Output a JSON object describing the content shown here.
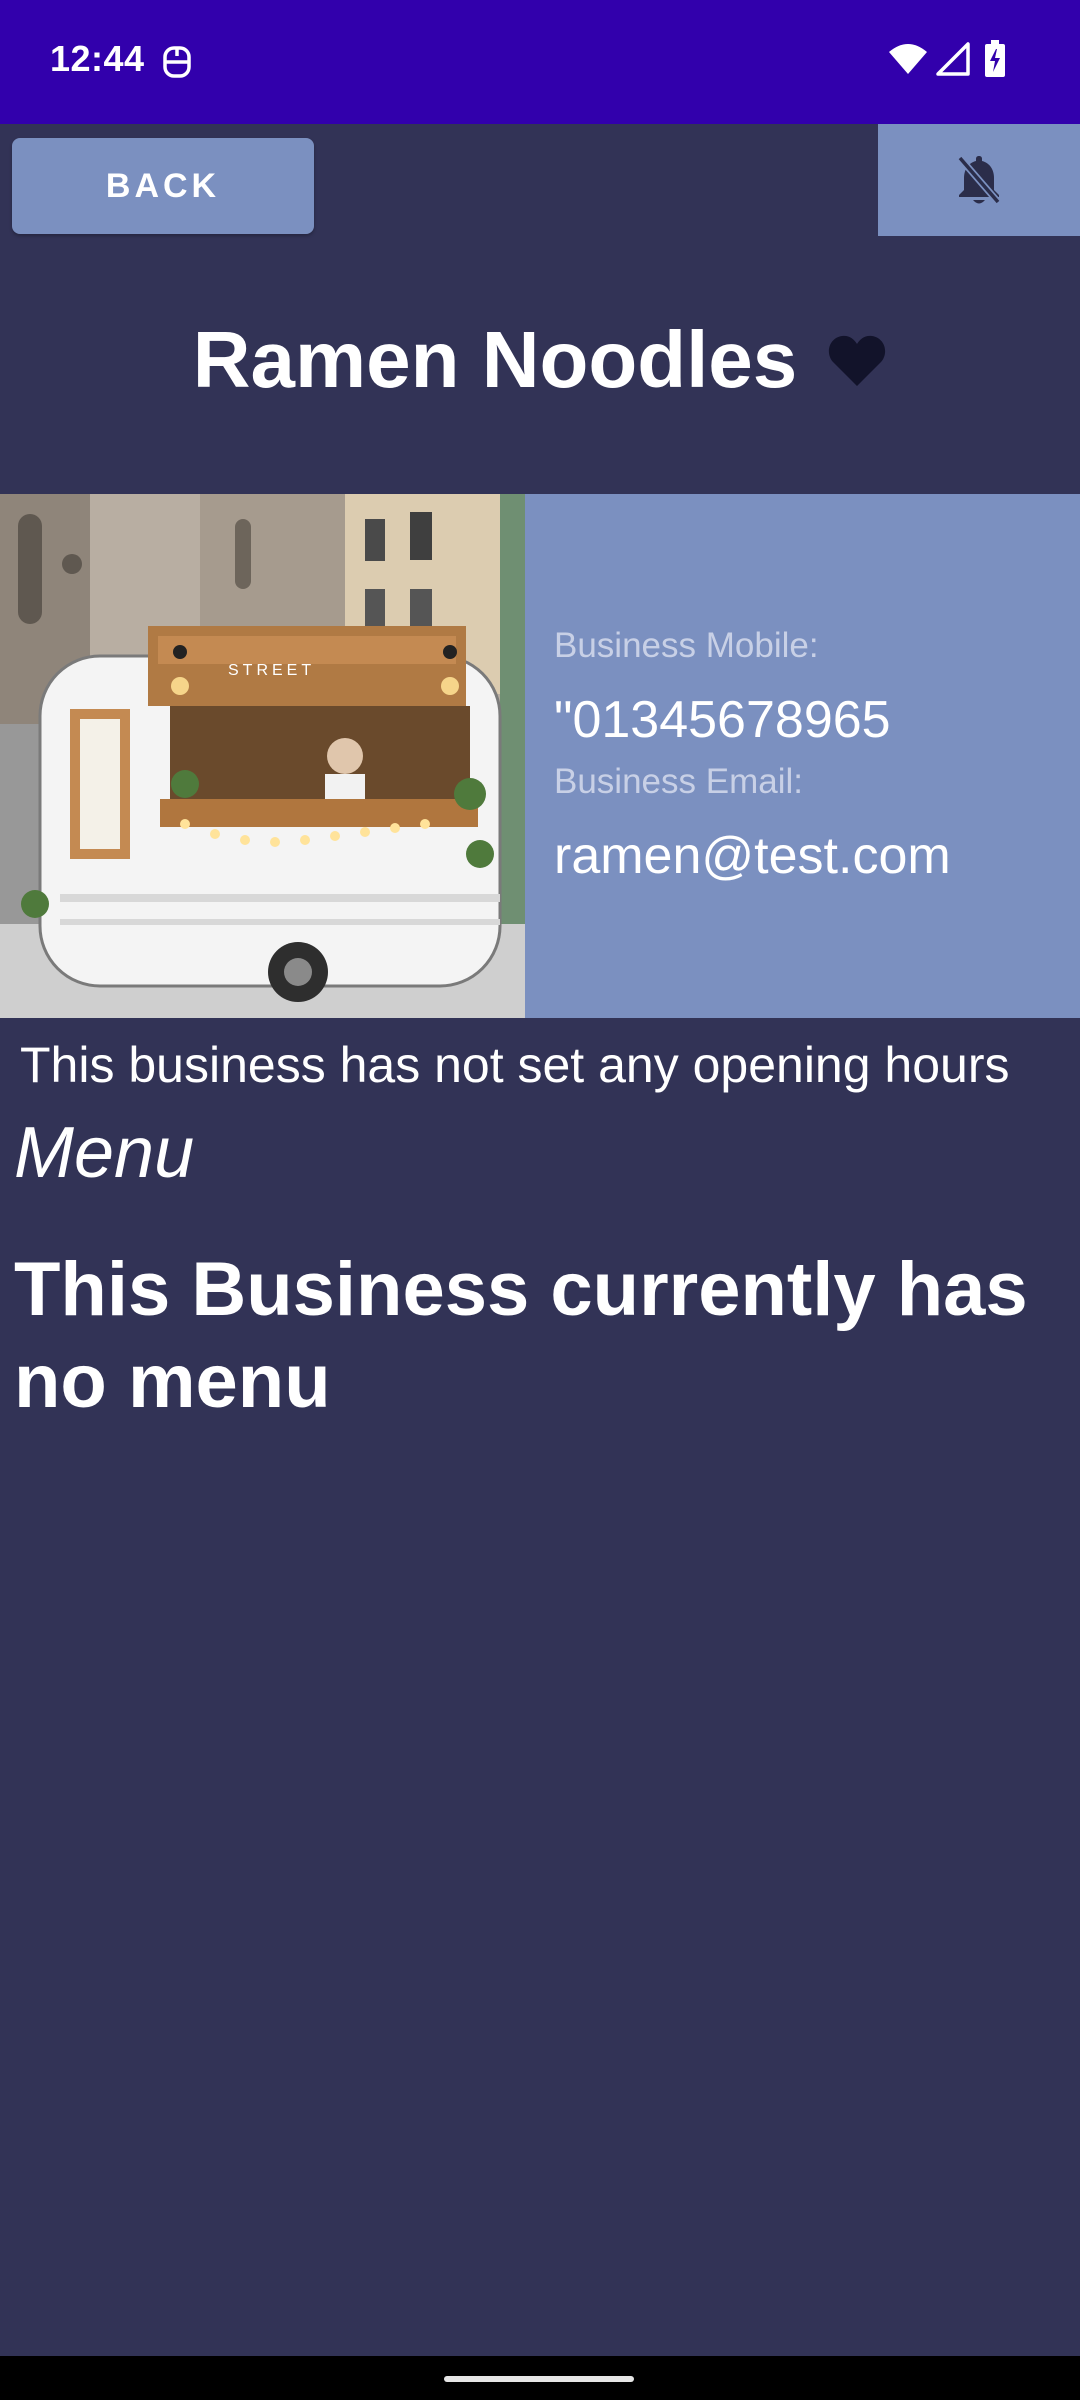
{
  "status_bar": {
    "time": "12:44",
    "icons": [
      "app-notification-icon",
      "wifi-icon",
      "cell-signal-icon",
      "battery-charging-icon"
    ]
  },
  "toolbar": {
    "back_label": "BACK",
    "notify_icon": "notifications-off-icon"
  },
  "business": {
    "name": "Ramen Noodles",
    "favorite_icon": "heart-icon",
    "mobile_label": "Business Mobile:",
    "mobile_value": "\"01345678965",
    "email_label": "Business Email:",
    "email_value": "ramen@test.com",
    "image_desc_icon": "food-truck-photo"
  },
  "opening_hours": {
    "text": "This business has not set any opening hours"
  },
  "menu": {
    "heading": "Menu",
    "empty_text": "This Business currently has no menu"
  },
  "colors": {
    "status_bar": "#3200ac",
    "background": "#323356",
    "accent": "#7b90c0",
    "heart": "#12132a"
  }
}
